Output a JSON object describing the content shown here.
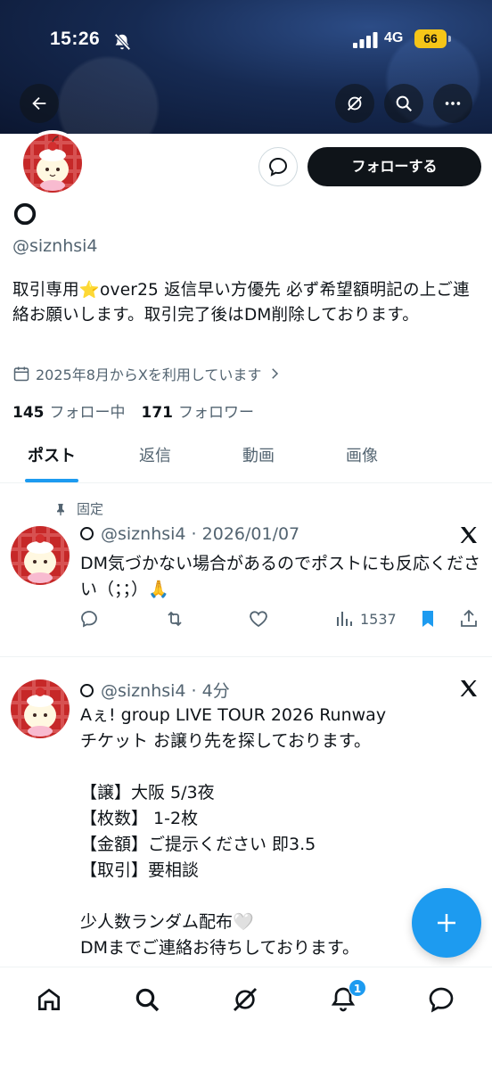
{
  "status": {
    "time": "15:26",
    "network": "4G",
    "battery": "66"
  },
  "profile": {
    "display_name": "",
    "handle": "@siznhsi4",
    "bio": "取引専用⭐️over25 返信早い方優先 必ず希望額明記の上ご連絡お願いします。取引完了後はDM削除しております。",
    "joined": "2025年8月からXを利用しています",
    "following_count": "145",
    "following_label": "フォロー中",
    "followers_count": "171",
    "followers_label": "フォロワー",
    "follow_button": "フォローする"
  },
  "tabs": [
    {
      "label": "ポスト",
      "active": true
    },
    {
      "label": "返信",
      "active": false
    },
    {
      "label": "動画",
      "active": false
    },
    {
      "label": "画像",
      "active": false
    }
  ],
  "posts": [
    {
      "pinned_label": "固定",
      "handle": "@siznhsi4",
      "time": "2026/01/07",
      "text": "DM気づかない場合があるのでポストにも反応ください（；；）🙏",
      "views": "1537",
      "bookmarked": true
    },
    {
      "handle": "@siznhsi4",
      "time": "4分",
      "text": "Aぇ! group LIVE TOUR 2026 Runway\nチケット お譲り先を探しております。\n\n【譲】大阪 5/3夜\n【枚数】 1-2枚\n【金額】ご提示ください 即3.5\n【取引】要相談\n\n少人数ランダム配布🤍\nDMまでご連絡お待ちしております。"
    }
  ],
  "nav": {
    "notifications_badge": "1"
  },
  "colors": {
    "accent": "#1d9bf0",
    "text": "#0f1419",
    "muted": "#536471"
  }
}
